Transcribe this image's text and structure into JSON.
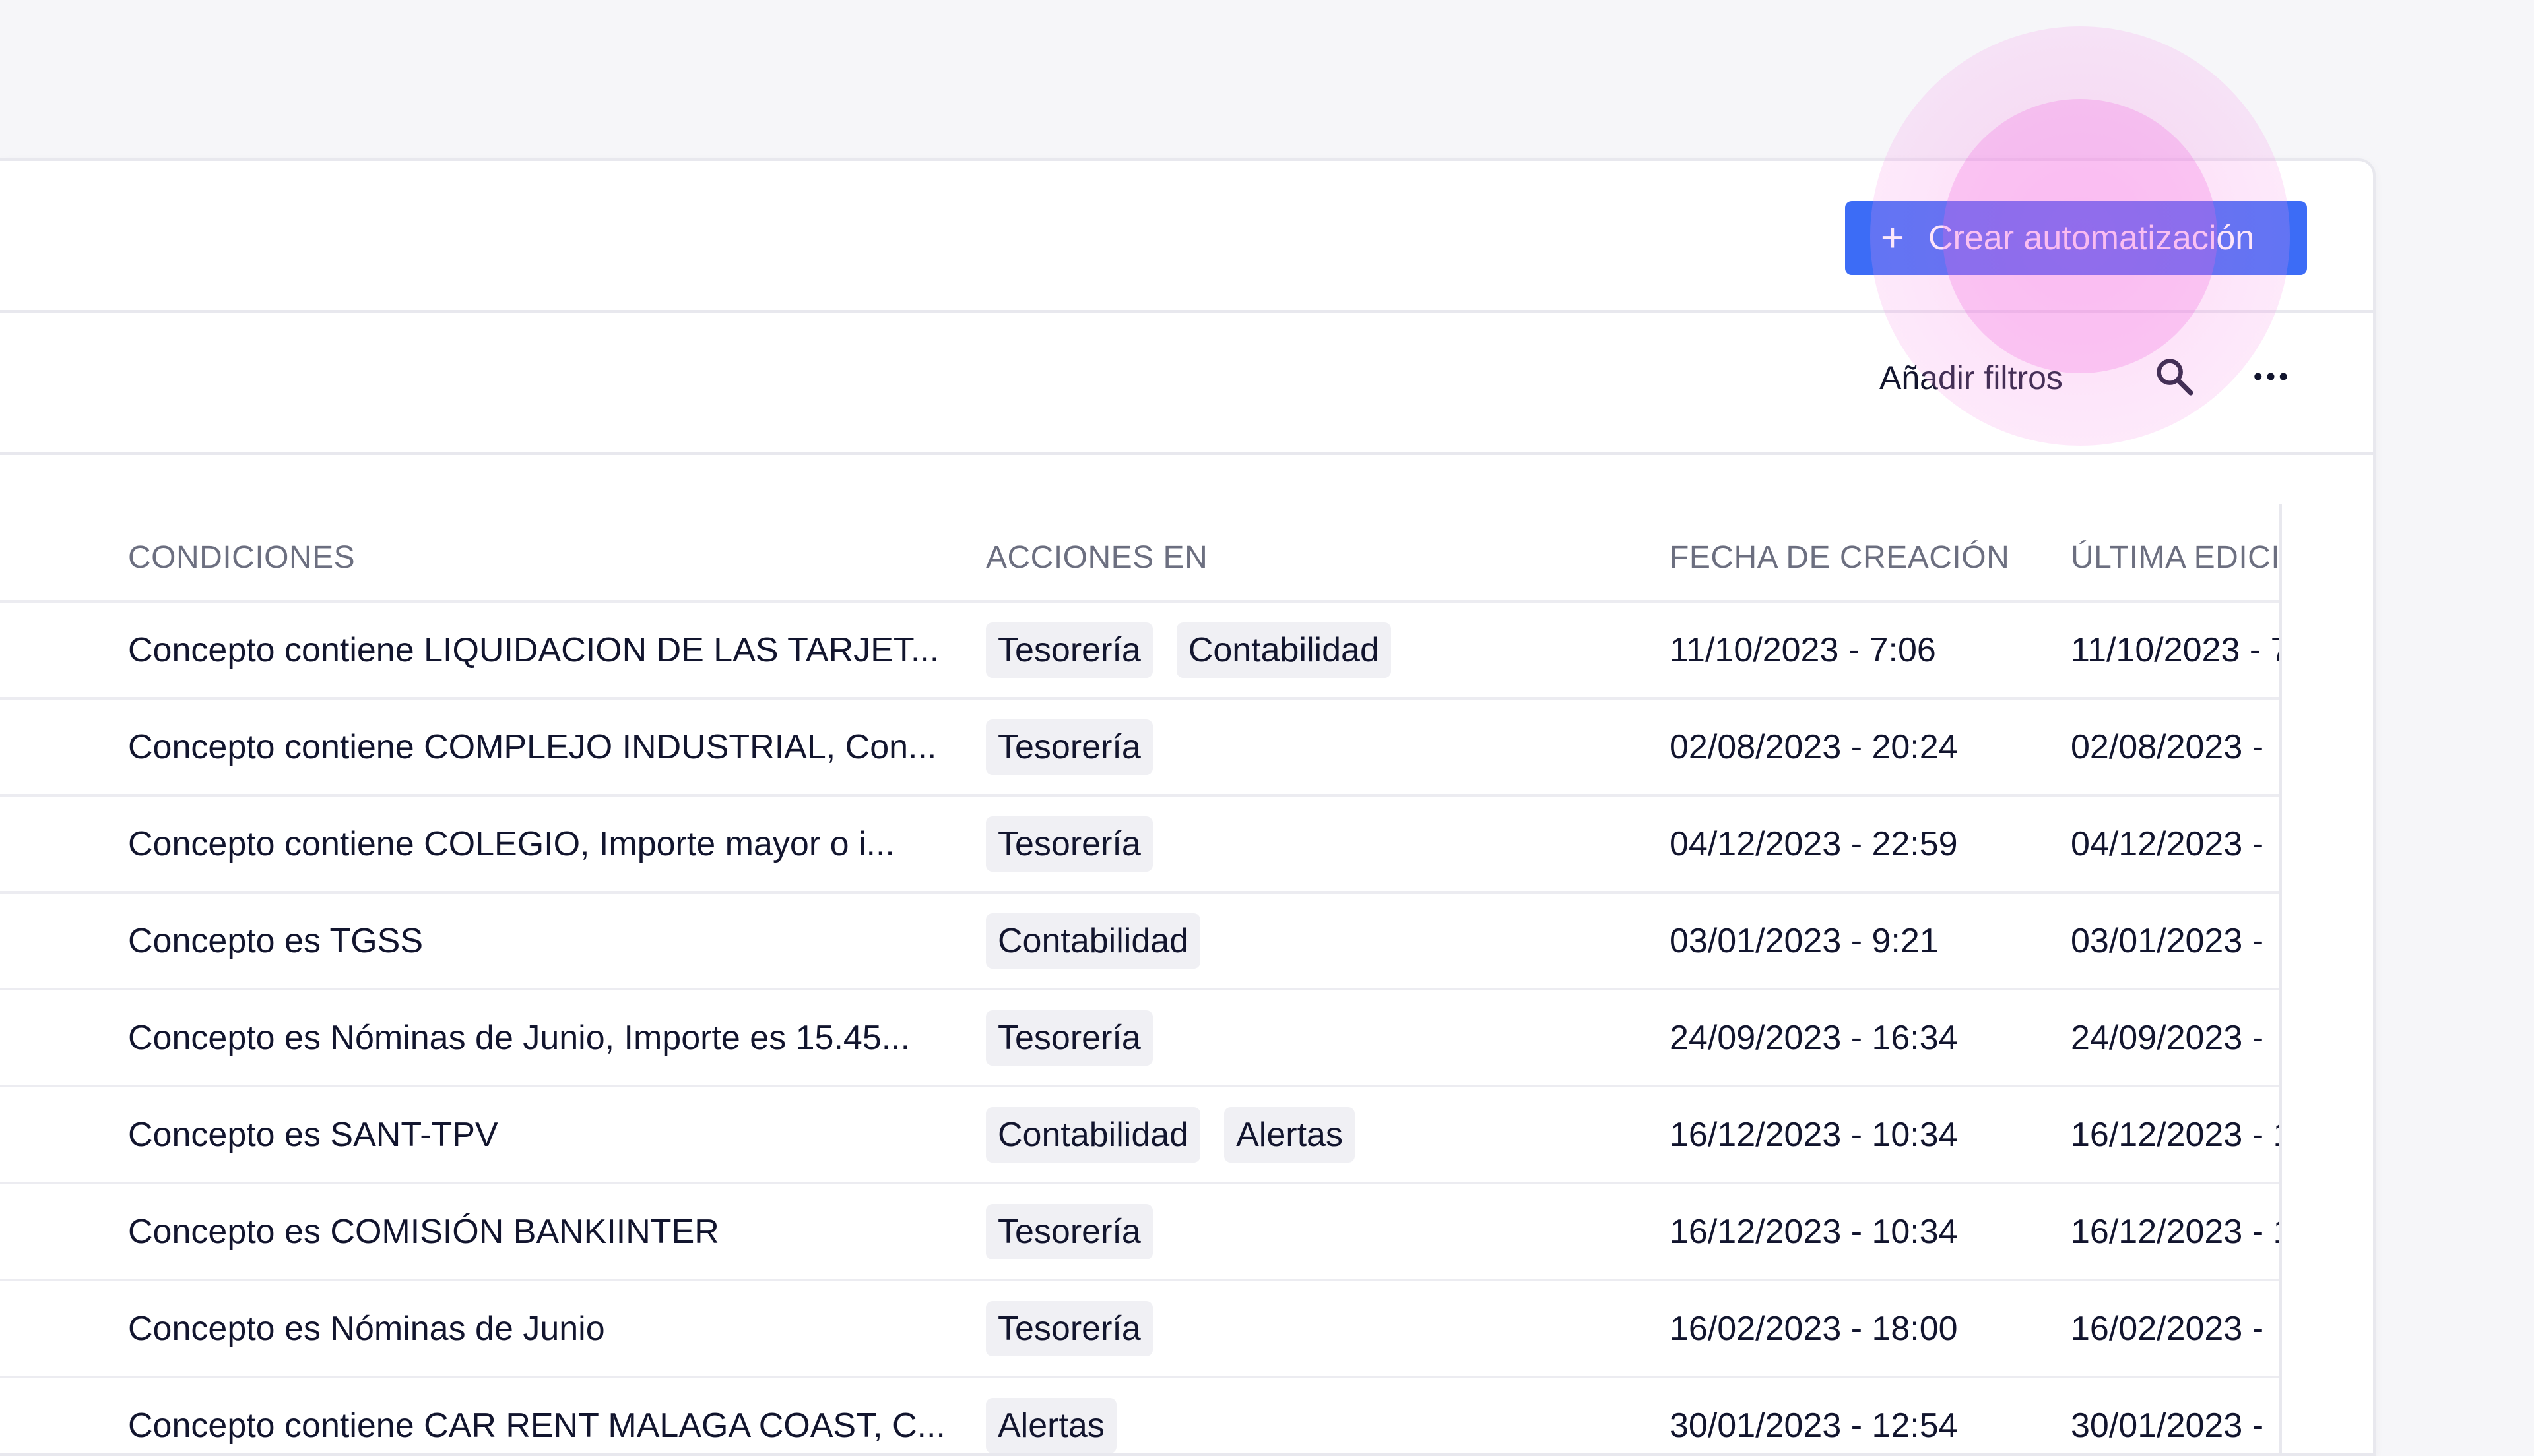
{
  "header": {
    "create_button_label": "Crear automatización",
    "create_button_icon": "plus-icon"
  },
  "toolbar": {
    "filters_label": "Añadir filtros",
    "search_icon": "search-icon",
    "more_icon": "more-horizontal-icon"
  },
  "table": {
    "columns": [
      "CONDICIONES",
      "ACCIONES EN",
      "FECHA DE CREACIÓN",
      "ÚLTIMA EDICI"
    ],
    "rows": [
      {
        "condition": "Concepto contiene LIQUIDACION DE LAS TARJET...",
        "actions": [
          "Tesorería",
          "Contabilidad"
        ],
        "created": "11/10/2023 - 7:06",
        "edited": "11/10/2023 - 7"
      },
      {
        "condition": "Concepto contiene COMPLEJO INDUSTRIAL, Con...",
        "actions": [
          "Tesorería"
        ],
        "created": "02/08/2023 - 20:24",
        "edited": "02/08/2023 -"
      },
      {
        "condition": "Concepto contiene COLEGIO, Importe mayor o i...",
        "actions": [
          "Tesorería"
        ],
        "created": "04/12/2023 - 22:59",
        "edited": "04/12/2023 -"
      },
      {
        "condition": "Concepto es TGSS",
        "actions": [
          "Contabilidad"
        ],
        "created": "03/01/2023 - 9:21",
        "edited": "03/01/2023 -"
      },
      {
        "condition": "Concepto es Nóminas de Junio, Importe es 15.45...",
        "actions": [
          "Tesorería"
        ],
        "created": "24/09/2023 - 16:34",
        "edited": "24/09/2023 -"
      },
      {
        "condition": "Concepto es SANT-TPV",
        "actions": [
          "Contabilidad",
          "Alertas"
        ],
        "created": "16/12/2023 - 10:34",
        "edited": "16/12/2023 - 1"
      },
      {
        "condition": "Concepto es COMISIÓN BANKIINTER",
        "actions": [
          "Tesorería"
        ],
        "created": "16/12/2023 - 10:34",
        "edited": "16/12/2023 - 1"
      },
      {
        "condition": "Concepto es Nóminas de Junio",
        "actions": [
          "Tesorería"
        ],
        "created": "16/02/2023 - 18:00",
        "edited": "16/02/2023 -"
      },
      {
        "condition": "Concepto contiene CAR RENT MALAGA COAST, C...",
        "actions": [
          "Alertas"
        ],
        "created": "30/01/2023 - 12:54",
        "edited": "30/01/2023 -"
      }
    ]
  },
  "colors": {
    "accent": "#3c6cf6",
    "highlight": "#f478e2",
    "tag_background": "#f0f0f4",
    "page_background": "#f6f6f9"
  }
}
